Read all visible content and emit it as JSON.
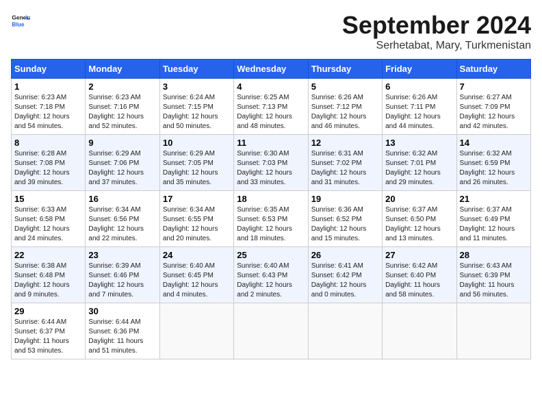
{
  "header": {
    "logo_line1": "General",
    "logo_line2": "Blue",
    "title": "September 2024",
    "subtitle": "Serhetabat, Mary, Turkmenistan"
  },
  "weekdays": [
    "Sunday",
    "Monday",
    "Tuesday",
    "Wednesday",
    "Thursday",
    "Friday",
    "Saturday"
  ],
  "weeks": [
    [
      {
        "day": "1",
        "info": "Sunrise: 6:23 AM\nSunset: 7:18 PM\nDaylight: 12 hours\nand 54 minutes."
      },
      {
        "day": "2",
        "info": "Sunrise: 6:23 AM\nSunset: 7:16 PM\nDaylight: 12 hours\nand 52 minutes."
      },
      {
        "day": "3",
        "info": "Sunrise: 6:24 AM\nSunset: 7:15 PM\nDaylight: 12 hours\nand 50 minutes."
      },
      {
        "day": "4",
        "info": "Sunrise: 6:25 AM\nSunset: 7:13 PM\nDaylight: 12 hours\nand 48 minutes."
      },
      {
        "day": "5",
        "info": "Sunrise: 6:26 AM\nSunset: 7:12 PM\nDaylight: 12 hours\nand 46 minutes."
      },
      {
        "day": "6",
        "info": "Sunrise: 6:26 AM\nSunset: 7:11 PM\nDaylight: 12 hours\nand 44 minutes."
      },
      {
        "day": "7",
        "info": "Sunrise: 6:27 AM\nSunset: 7:09 PM\nDaylight: 12 hours\nand 42 minutes."
      }
    ],
    [
      {
        "day": "8",
        "info": "Sunrise: 6:28 AM\nSunset: 7:08 PM\nDaylight: 12 hours\nand 39 minutes."
      },
      {
        "day": "9",
        "info": "Sunrise: 6:29 AM\nSunset: 7:06 PM\nDaylight: 12 hours\nand 37 minutes."
      },
      {
        "day": "10",
        "info": "Sunrise: 6:29 AM\nSunset: 7:05 PM\nDaylight: 12 hours\nand 35 minutes."
      },
      {
        "day": "11",
        "info": "Sunrise: 6:30 AM\nSunset: 7:03 PM\nDaylight: 12 hours\nand 33 minutes."
      },
      {
        "day": "12",
        "info": "Sunrise: 6:31 AM\nSunset: 7:02 PM\nDaylight: 12 hours\nand 31 minutes."
      },
      {
        "day": "13",
        "info": "Sunrise: 6:32 AM\nSunset: 7:01 PM\nDaylight: 12 hours\nand 29 minutes."
      },
      {
        "day": "14",
        "info": "Sunrise: 6:32 AM\nSunset: 6:59 PM\nDaylight: 12 hours\nand 26 minutes."
      }
    ],
    [
      {
        "day": "15",
        "info": "Sunrise: 6:33 AM\nSunset: 6:58 PM\nDaylight: 12 hours\nand 24 minutes."
      },
      {
        "day": "16",
        "info": "Sunrise: 6:34 AM\nSunset: 6:56 PM\nDaylight: 12 hours\nand 22 minutes."
      },
      {
        "day": "17",
        "info": "Sunrise: 6:34 AM\nSunset: 6:55 PM\nDaylight: 12 hours\nand 20 minutes."
      },
      {
        "day": "18",
        "info": "Sunrise: 6:35 AM\nSunset: 6:53 PM\nDaylight: 12 hours\nand 18 minutes."
      },
      {
        "day": "19",
        "info": "Sunrise: 6:36 AM\nSunset: 6:52 PM\nDaylight: 12 hours\nand 15 minutes."
      },
      {
        "day": "20",
        "info": "Sunrise: 6:37 AM\nSunset: 6:50 PM\nDaylight: 12 hours\nand 13 minutes."
      },
      {
        "day": "21",
        "info": "Sunrise: 6:37 AM\nSunset: 6:49 PM\nDaylight: 12 hours\nand 11 minutes."
      }
    ],
    [
      {
        "day": "22",
        "info": "Sunrise: 6:38 AM\nSunset: 6:48 PM\nDaylight: 12 hours\nand 9 minutes."
      },
      {
        "day": "23",
        "info": "Sunrise: 6:39 AM\nSunset: 6:46 PM\nDaylight: 12 hours\nand 7 minutes."
      },
      {
        "day": "24",
        "info": "Sunrise: 6:40 AM\nSunset: 6:45 PM\nDaylight: 12 hours\nand 4 minutes."
      },
      {
        "day": "25",
        "info": "Sunrise: 6:40 AM\nSunset: 6:43 PM\nDaylight: 12 hours\nand 2 minutes."
      },
      {
        "day": "26",
        "info": "Sunrise: 6:41 AM\nSunset: 6:42 PM\nDaylight: 12 hours\nand 0 minutes."
      },
      {
        "day": "27",
        "info": "Sunrise: 6:42 AM\nSunset: 6:40 PM\nDaylight: 11 hours\nand 58 minutes."
      },
      {
        "day": "28",
        "info": "Sunrise: 6:43 AM\nSunset: 6:39 PM\nDaylight: 11 hours\nand 56 minutes."
      }
    ],
    [
      {
        "day": "29",
        "info": "Sunrise: 6:44 AM\nSunset: 6:37 PM\nDaylight: 11 hours\nand 53 minutes."
      },
      {
        "day": "30",
        "info": "Sunrise: 6:44 AM\nSunset: 6:36 PM\nDaylight: 11 hours\nand 51 minutes."
      },
      {
        "day": "",
        "info": ""
      },
      {
        "day": "",
        "info": ""
      },
      {
        "day": "",
        "info": ""
      },
      {
        "day": "",
        "info": ""
      },
      {
        "day": "",
        "info": ""
      }
    ]
  ]
}
